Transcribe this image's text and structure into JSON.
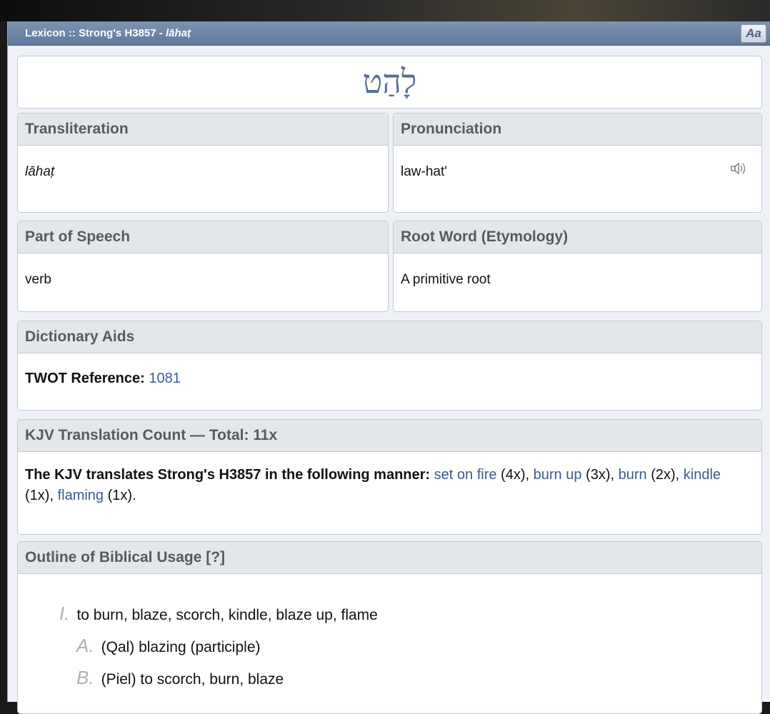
{
  "title_bar": {
    "prefix": "Lexicon :: Strong's H3857 - ",
    "translit": "lāhaṭ",
    "font_button": "Aa"
  },
  "word": {
    "hebrew": "לָהַט"
  },
  "transliteration": {
    "header": "Transliteration",
    "value": "lāhaṭ"
  },
  "pronunciation": {
    "header": "Pronunciation",
    "value": "law-hat'",
    "icon": "speaker-icon"
  },
  "part_of_speech": {
    "header": "Part of Speech",
    "value": "verb"
  },
  "root_word": {
    "header": "Root Word (Etymology)",
    "value": "A primitive root"
  },
  "dictionary_aids": {
    "header": "Dictionary Aids",
    "twot_label": "TWOT Reference:",
    "twot_value": "1081"
  },
  "kjv_count": {
    "header": "KJV Translation Count — Total: 11x",
    "intro": "The KJV translates Strong's H3857 in the following manner:",
    "items": [
      {
        "word": "set on fire",
        "count": "(4x)",
        "sep": ","
      },
      {
        "word": "burn up",
        "count": "(3x)",
        "sep": ","
      },
      {
        "word": "burn",
        "count": "(2x)",
        "sep": ","
      },
      {
        "word": "kindle",
        "count": "(1x)",
        "sep": ","
      },
      {
        "word": "flaming",
        "count": "(1x)",
        "sep": "."
      }
    ]
  },
  "outline": {
    "header": "Outline of Biblical Usage [?]",
    "items": [
      {
        "num": "I.",
        "text": "to burn, blaze, scorch, kindle, blaze up, flame"
      },
      {
        "num": "A.",
        "text": "(Qal) blazing (participle)"
      },
      {
        "num": "B.",
        "text": "(Piel) to scorch, burn, blaze"
      }
    ]
  }
}
